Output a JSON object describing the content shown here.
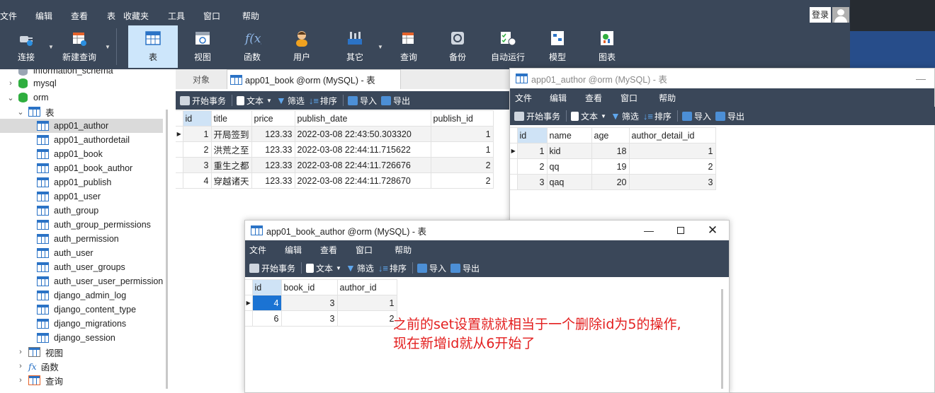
{
  "app": {
    "menu": [
      "文件",
      "编辑",
      "查看",
      "表",
      "收藏夹",
      "工具",
      "窗口",
      "帮助"
    ],
    "login": "登录",
    "toolbar": [
      {
        "label": "连接",
        "icon": "plug-icon"
      },
      {
        "label": "新建查询",
        "icon": "new-query-icon"
      },
      {
        "label": "表",
        "icon": "table-icon"
      },
      {
        "label": "视图",
        "icon": "view-icon"
      },
      {
        "label": "函数",
        "icon": "function-icon"
      },
      {
        "label": "用户",
        "icon": "user-icon"
      },
      {
        "label": "其它",
        "icon": "tools-icon"
      },
      {
        "label": "查询",
        "icon": "query-icon"
      },
      {
        "label": "备份",
        "icon": "backup-icon"
      },
      {
        "label": "自动运行",
        "icon": "schedule-icon"
      },
      {
        "label": "模型",
        "icon": "model-icon"
      },
      {
        "label": "图表",
        "icon": "chart-icon"
      }
    ]
  },
  "sidebar": {
    "partial_top": "information_schema",
    "databases": [
      "mysql",
      "orm"
    ],
    "tables_label": "表",
    "tables": [
      "app01_author",
      "app01_authordetail",
      "app01_book",
      "app01_book_author",
      "app01_publish",
      "app01_user",
      "auth_group",
      "auth_group_permissions",
      "auth_permission",
      "auth_user",
      "auth_user_groups",
      "auth_user_user_permission",
      "django_admin_log",
      "django_content_type",
      "django_migrations",
      "django_session"
    ],
    "groups": [
      "视图",
      "函数",
      "查询"
    ]
  },
  "book_tab": {
    "objects_tab": "对象",
    "title": "app01_book @orm (MySQL) - 表",
    "subtoolbar": {
      "begin": "开始事务",
      "text": "文本",
      "filter": "筛选",
      "sort": "排序",
      "import": "导入",
      "export": "导出"
    },
    "columns": [
      "id",
      "title",
      "price",
      "publish_date",
      "publish_id"
    ],
    "rows": [
      [
        "1",
        "开局签到",
        "123.33",
        "2022-03-08 22:43:50.303320",
        "1"
      ],
      [
        "2",
        "洪荒之至",
        "123.33",
        "2022-03-08 22:44:11.715622",
        "1"
      ],
      [
        "3",
        "重生之都",
        "123.33",
        "2022-03-08 22:44:11.726676",
        "2"
      ],
      [
        "4",
        "穿越诸天",
        "123.33",
        "2022-03-08 22:44:11.728670",
        "2"
      ]
    ]
  },
  "author_win": {
    "title": "app01_author @orm (MySQL) - 表",
    "menu": [
      "文件",
      "编辑",
      "查看",
      "窗口",
      "帮助"
    ],
    "subtoolbar": {
      "begin": "开始事务",
      "text": "文本",
      "filter": "筛选",
      "sort": "排序",
      "import": "导入",
      "export": "导出"
    },
    "columns": [
      "id",
      "name",
      "age",
      "author_detail_id"
    ],
    "rows": [
      [
        "1",
        "kid",
        "18",
        "1"
      ],
      [
        "2",
        "qq",
        "19",
        "2"
      ],
      [
        "3",
        "qaq",
        "20",
        "3"
      ]
    ]
  },
  "ba_win": {
    "title": "app01_book_author @orm (MySQL) - 表",
    "menu": [
      "文件",
      "编辑",
      "查看",
      "窗口",
      "帮助"
    ],
    "subtoolbar": {
      "begin": "开始事务",
      "text": "文本",
      "filter": "筛选",
      "sort": "排序",
      "import": "导入",
      "export": "导出"
    },
    "columns": [
      "id",
      "book_id",
      "author_id"
    ],
    "rows": [
      [
        "4",
        "3",
        "1"
      ],
      [
        "6",
        "3",
        "2"
      ]
    ]
  },
  "annotation": {
    "line1": "之前的set设置就就相当于一个删除id为5的操作,",
    "line2": "现在新增id就从6开始了"
  },
  "colors": {
    "toolbar_bg": "#3a4759",
    "active_tool": "#cde6fb",
    "selection": "#1b73d3",
    "annotation": "#e31e1e"
  }
}
